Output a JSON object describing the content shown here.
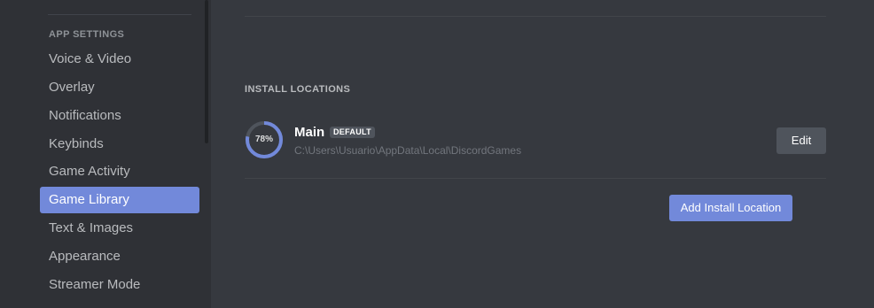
{
  "sidebar": {
    "section_header": "App Settings",
    "items": [
      {
        "label": "Voice & Video",
        "active": false
      },
      {
        "label": "Overlay",
        "active": false
      },
      {
        "label": "Notifications",
        "active": false
      },
      {
        "label": "Keybinds",
        "active": false
      },
      {
        "label": "Game Activity",
        "active": false
      },
      {
        "label": "Game Library",
        "active": true
      },
      {
        "label": "Text & Images",
        "active": false
      },
      {
        "label": "Appearance",
        "active": false
      },
      {
        "label": "Streamer Mode",
        "active": false
      }
    ]
  },
  "main": {
    "section_title": "Install Locations",
    "locations": [
      {
        "name": "Main",
        "badge": "DEFAULT",
        "path": "C:\\Users\\Usuario\\AppData\\Local\\DiscordGames",
        "usage_label": "78%",
        "usage_fraction": 0.78,
        "edit_label": "Edit"
      }
    ],
    "add_location_label": "Add Install Location"
  },
  "colors": {
    "accent": "#7289da",
    "sidebar_bg": "#2f3136",
    "content_bg": "#36393f",
    "ring_track": "#4f545c"
  }
}
